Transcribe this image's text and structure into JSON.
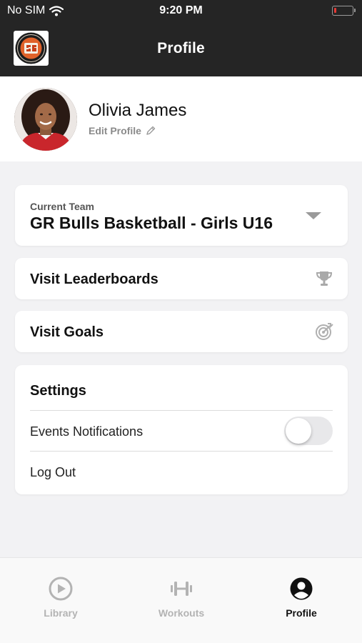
{
  "status_bar": {
    "carrier": "No SIM",
    "time": "9:20 PM"
  },
  "nav": {
    "title": "Profile",
    "logo_icon": "club-crest-icon"
  },
  "profile": {
    "name": "Olivia James",
    "edit_label": "Edit Profile"
  },
  "team_selector": {
    "label": "Current Team",
    "value": "GR Bulls Basketball - Girls U16"
  },
  "links": {
    "leaderboards": "Visit Leaderboards",
    "goals": "Visit Goals"
  },
  "settings": {
    "title": "Settings",
    "events_notifications": "Events Notifications",
    "events_notifications_enabled": false,
    "log_out": "Log Out"
  },
  "tabs": [
    {
      "label": "Library",
      "icon": "play-circle-icon",
      "active": false
    },
    {
      "label": "Workouts",
      "icon": "dumbbell-icon",
      "active": false
    },
    {
      "label": "Profile",
      "icon": "user-circle-icon",
      "active": true
    }
  ],
  "colors": {
    "header_bg": "#252525",
    "page_bg": "#f2f2f4",
    "inactive_tab": "#b3b3b3",
    "active_tab": "#111111",
    "battery_low": "#e53935"
  }
}
